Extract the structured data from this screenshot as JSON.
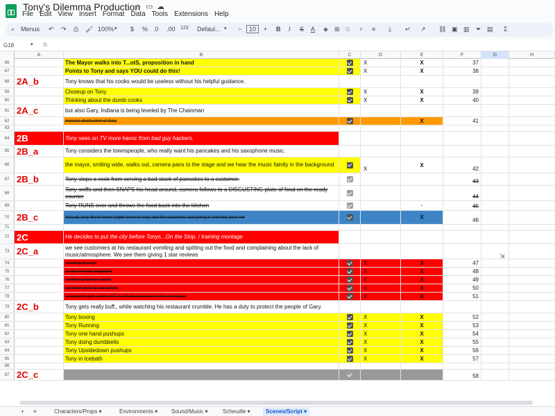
{
  "app": {
    "title": "Tony's Dilemma Production"
  },
  "menu": [
    "File",
    "Edit",
    "View",
    "Insert",
    "Format",
    "Data",
    "Tools",
    "Extensions",
    "Help"
  ],
  "toolbar": {
    "menus_label": "Menus",
    "zoom": "100%",
    "currency": "$",
    "percent": "%",
    "dec_decrease": ".0",
    "dec_increase": ".00",
    "number_format": "123",
    "font": "Defaul...",
    "font_size": "10",
    "bold": "B",
    "italic": "I",
    "strike": "S",
    "text_color": "A",
    "sigma": "Σ"
  },
  "formula_bar": {
    "cell_ref": "G18",
    "fx": "fx",
    "value": ""
  },
  "columns": [
    "A",
    "B",
    "C",
    "D",
    "E",
    "F",
    "G",
    "H"
  ],
  "rows": [
    {
      "n": "66",
      "a": "",
      "b": "The Mayor walks into T...otS, proposition in hand",
      "bstyle": "bold",
      "bg": "#ffff00",
      "cbg": "#ffff00",
      "check": true,
      "d": "X",
      "e": "X",
      "f": "37"
    },
    {
      "n": "67",
      "a": "",
      "b": "Points to Tony and says YOU could do this!",
      "bstyle": "bold",
      "bg": "#ffff00",
      "cbg": "#ffff00",
      "check": true,
      "d": "X",
      "e": "X",
      "f": "38"
    },
    {
      "n": "68",
      "a": "2A_b",
      "b": "Tony knows that his cooks would be useless without his helpful guidance.",
      "bg": "",
      "check": false,
      "h": 18
    },
    {
      "n": "59",
      "a": "",
      "b": "Closeup on Tony",
      "bg": "#ffff00",
      "cbg": "#ffff00",
      "check": true,
      "d": "X",
      "e": "X",
      "f": "39"
    },
    {
      "n": "60",
      "a": "",
      "b": "Thinking about the dumb cooks",
      "bg": "#ffff00",
      "cbg": "#ffff00",
      "check": true,
      "d": "X",
      "e": "X",
      "f": "40"
    },
    {
      "n": "61",
      "a": "2A_c",
      "b": "but also Gary, Indiana is being leveled by The Chainman",
      "bg": "",
      "check": false,
      "h": 18
    },
    {
      "n": "62",
      "a": "",
      "b": "massive destruction of Gary",
      "bstyle": "italic small strike",
      "bg": "#ff9900",
      "cbg": "#ff9900",
      "dbg": "#ff9900",
      "ebg": "#ff9900",
      "check": true,
      "d": "",
      "e": "X",
      "f": "41"
    },
    {
      "n": "63",
      "a": "",
      "b": "",
      "bg": "",
      "check": false,
      "h": 9
    },
    {
      "n": "64",
      "a": "2B",
      "b": "Tony sees on TV more havoc from bad guy hackers.",
      "bstyle": "italic white",
      "bg": "#ff0000",
      "abg": "#ff0000",
      "awhite": true,
      "check": false,
      "h": 20
    },
    {
      "n": "65",
      "a": "2B_a",
      "b": "Tony considers the townspeople, who really want his pancakes and his saxophone music.",
      "bg": "",
      "check": false,
      "h": 17
    },
    {
      "n": "66",
      "a": "",
      "b": "the mayor, smiling wide, walks out, camera pans to the stage  and we hear the music faintly in the background",
      "bg": "#ffff00",
      "cbg": "#ffff00",
      "check": true,
      "d": "X",
      "e": "X",
      "f": "42",
      "h": 23
    },
    {
      "n": "67",
      "a": "2B_b",
      "b": "Tony stops a cook from serving a bad stack of pancakes to a customer.",
      "bstyle": "strike",
      "bg": "",
      "check": true,
      "grey": true,
      "f": "43",
      "fstrike": true,
      "h": 18
    },
    {
      "n": "68",
      "a": "",
      "b": "Tony sniffs and then SNAPS his head around, camera follows to a DISGUSTING plate of food on the ready counter",
      "bstyle": "strike",
      "bg": "",
      "check": true,
      "grey": true,
      "f": "44",
      "fstrike": true,
      "h": 22
    },
    {
      "n": "69",
      "a": "",
      "b": "Tony RUNS over and throws the food back into the kitchen",
      "bstyle": "strike",
      "bg": "",
      "check": true,
      "grey": true,
      "e": "·",
      "f": "45",
      "fstrike": true,
      "h": 14
    },
    {
      "n": "70",
      "a": "2B_c",
      "b": "instead, tony drives home (rights turns to stay) and the customers start piling in, but tony does not",
      "bstyle": "small strike",
      "bg": "#3d85c6",
      "cbg": "#3d85c6",
      "dbg": "#3d85c6",
      "ebg": "#3d85c6",
      "check": true,
      "e": "X",
      "f": "46",
      "h": 20
    },
    {
      "n": "71",
      "a": "",
      "b": "",
      "bg": "",
      "check": false,
      "h": 9
    },
    {
      "n": "72",
      "a": "2C",
      "b": "He decides to put the city before Tonys...On the Strip. / training montage",
      "bstyle": "italic white",
      "bg": "#ff0000",
      "abg": "#ff0000",
      "awhite": true,
      "check": false,
      "h": 19
    },
    {
      "n": "73",
      "a": "2C_a",
      "b": "we see customers at his restaurant vomiting and spitting out the food and complaining about the lack of music/atmosphere. We see them giving 1 star reviews",
      "bg": "",
      "check": false,
      "h": 22
    },
    {
      "n": "74",
      "a": "",
      "b": "vomiting at tonys",
      "bstyle": "small strike",
      "bg": "#ff0000",
      "cbg": "#ff0000",
      "dbg": "#ff0000",
      "ebg": "#ff0000",
      "check": true,
      "d": "X",
      "e": "X",
      "f": "47"
    },
    {
      "n": "75",
      "a": "",
      "b": "customer looks disgusted",
      "bstyle": "small strike",
      "bg": "#ff0000",
      "cbg": "#ff0000",
      "dbg": "#ff0000",
      "ebg": "#ff0000",
      "check": true,
      "d": "X",
      "e": "X",
      "f": "48"
    },
    {
      "n": "76",
      "a": "",
      "b": "Another customer vomits",
      "bstyle": "small strike",
      "bg": "#ff0000",
      "cbg": "#ff0000",
      "dbg": "#ff0000",
      "ebg": "#ff0000",
      "check": true,
      "d": "X",
      "e": "X",
      "f": "49"
    },
    {
      "n": "77",
      "a": "",
      "b": "customer gives 1 star review",
      "bstyle": "small strike",
      "bg": "#ff0000",
      "cbg": "#ff0000",
      "dbg": "#ff0000",
      "ebg": "#ff0000",
      "check": true,
      "d": "X",
      "e": "X",
      "f": "50"
    },
    {
      "n": "78",
      "a": "",
      "b": "a customer gets a dust mite in a back and is taken fine in the face",
      "bstyle": "small strike",
      "bg": "#ff0000",
      "cbg": "#ff0000",
      "dbg": "#ff0000",
      "ebg": "#ff0000",
      "check": true,
      "d": "X",
      "e": "X",
      "f": "51"
    },
    {
      "n": "79",
      "a": "2C_b",
      "b": "Tony gets really buff,, while watching his restaurant crumble. He has a duty to protect the people of Gary.",
      "bg": "",
      "check": false,
      "h": 18
    },
    {
      "n": "80",
      "a": "",
      "b": "Tony boxing",
      "bg": "#ffff00",
      "cbg": "#ffff00",
      "dbg": "#ffff00",
      "ebg": "#ffff00",
      "check": true,
      "d": "X",
      "e": "X",
      "f": "52"
    },
    {
      "n": "81",
      "a": "",
      "b": "Tony Running",
      "bg": "#ffff00",
      "cbg": "#ffff00",
      "dbg": "#ffff00",
      "ebg": "#ffff00",
      "check": true,
      "d": "X",
      "e": "X",
      "f": "53"
    },
    {
      "n": "82",
      "a": "",
      "b": "Tony one hand pushups",
      "bg": "#ffff00",
      "cbg": "#ffff00",
      "dbg": "#ffff00",
      "ebg": "#ffff00",
      "check": true,
      "d": "X",
      "e": "X",
      "f": "54"
    },
    {
      "n": "83",
      "a": "",
      "b": "Tony doing dumbbells",
      "bg": "#ffff00",
      "cbg": "#ffff00",
      "dbg": "#ffff00",
      "ebg": "#ffff00",
      "check": true,
      "d": "X",
      "e": "X",
      "f": "55"
    },
    {
      "n": "84",
      "a": "",
      "b": "Tony Upsidedown pushups",
      "bg": "#ffff00",
      "cbg": "#ffff00",
      "dbg": "#ffff00",
      "ebg": "#ffff00",
      "check": true,
      "d": "X",
      "e": "X",
      "f": "56"
    },
    {
      "n": "85",
      "a": "",
      "b": "Tony in Icebath",
      "bg": "#ffff00",
      "cbg": "#ffff00",
      "dbg": "#ffff00",
      "ebg": "#ffff00",
      "check": true,
      "d": "X",
      "e": "X",
      "f": "57"
    },
    {
      "n": "86",
      "a": "",
      "b": "",
      "bg": "",
      "check": false,
      "h": 9
    },
    {
      "n": "87",
      "a": "2C_c",
      "b": "",
      "bg": "#999999",
      "cbg": "#999999",
      "dbg": "#999999",
      "ebg": "#999999",
      "check": true,
      "grey": true,
      "f": "58",
      "h": 16
    }
  ],
  "tabs": {
    "add": "+",
    "all_sheets": "≡",
    "sheets": [
      "Characters/Props",
      "Environments",
      "Sound/Music",
      "Scheudle",
      "Scenes/Script"
    ],
    "active": "Scenes/Script"
  }
}
